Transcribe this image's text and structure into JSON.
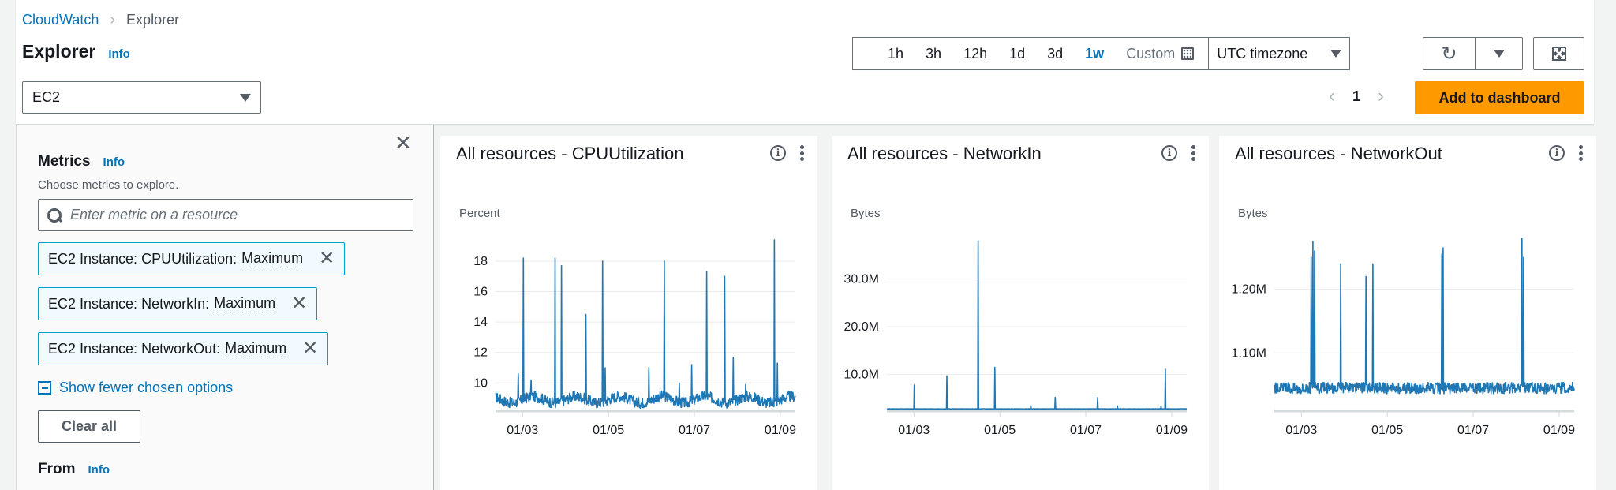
{
  "breadcrumb": {
    "parent": "CloudWatch",
    "current": "Explorer"
  },
  "header": {
    "title": "Explorer",
    "info": "Info"
  },
  "service_select": {
    "value": "EC2"
  },
  "time_range": {
    "options": [
      "1h",
      "3h",
      "12h",
      "1d",
      "3d",
      "1w"
    ],
    "selected": "1w",
    "custom_label": "Custom",
    "timezone": "UTC timezone"
  },
  "icons": {
    "refresh": "refresh-icon",
    "dropdown": "caret-down-icon",
    "fullscreen": "fullscreen-icon",
    "calendar": "calendar-icon"
  },
  "pager": {
    "prev": "‹",
    "page": "1",
    "next": "›"
  },
  "add_to_dashboard": "Add to dashboard",
  "side_panel": {
    "metrics_title": "Metrics",
    "metrics_info": "Info",
    "metrics_desc": "Choose metrics to explore.",
    "search_placeholder": "Enter metric on a resource",
    "tokens": [
      {
        "label": "EC2 Instance: CPUUtilization:",
        "stat": "Maximum"
      },
      {
        "label": "EC2 Instance: NetworkIn:",
        "stat": "Maximum"
      },
      {
        "label": "EC2 Instance: NetworkOut:",
        "stat": "Maximum"
      }
    ],
    "show_fewer": "Show fewer chosen options",
    "clear_all": "Clear all",
    "from_title": "From",
    "from_info": "Info"
  },
  "chart_data": [
    {
      "type": "line",
      "title": "All resources - CPUUtilization",
      "ylabel": "Percent",
      "xlabel": "",
      "y_ticks": [
        "10",
        "12",
        "14",
        "16",
        "18"
      ],
      "y_tick_values": [
        10,
        12,
        14,
        16,
        18
      ],
      "ylim": [
        8.2,
        19.5
      ],
      "x_ticks": [
        "01/03",
        "01/05",
        "01/07",
        "01/09"
      ],
      "x_tick_days": [
        3,
        5,
        7,
        9
      ],
      "xlim_days": [
        2.37,
        9.35
      ],
      "grid": true,
      "color": "#1f77b4",
      "baseline": 8.9,
      "noise": 0.35,
      "spikes": [
        {
          "day": 2.9,
          "value": 10.6
        },
        {
          "day": 3.02,
          "value": 18.2
        },
        {
          "day": 3.2,
          "value": 10.2
        },
        {
          "day": 3.76,
          "value": 18.2
        },
        {
          "day": 3.91,
          "value": 17.7
        },
        {
          "day": 4.47,
          "value": 14.5
        },
        {
          "day": 4.86,
          "value": 18.0
        },
        {
          "day": 4.92,
          "value": 11.0
        },
        {
          "day": 5.94,
          "value": 11.0
        },
        {
          "day": 6.3,
          "value": 18.0
        },
        {
          "day": 6.65,
          "value": 10.0
        },
        {
          "day": 6.94,
          "value": 11.2
        },
        {
          "day": 7.29,
          "value": 17.3
        },
        {
          "day": 7.7,
          "value": 17.0
        },
        {
          "day": 7.9,
          "value": 11.7
        },
        {
          "day": 8.19,
          "value": 9.9
        },
        {
          "day": 8.86,
          "value": 19.4
        },
        {
          "day": 8.93,
          "value": 11.3
        }
      ]
    },
    {
      "type": "line",
      "title": "All resources - NetworkIn",
      "ylabel": "Bytes",
      "xlabel": "",
      "y_ticks": [
        "10.0M",
        "20.0M",
        "30.0M"
      ],
      "y_tick_values": [
        10000000,
        20000000,
        30000000
      ],
      "ylim": [
        2500000,
        38500000
      ],
      "x_ticks": [
        "01/03",
        "01/05",
        "01/07",
        "01/09"
      ],
      "x_tick_days": [
        3,
        5,
        7,
        9
      ],
      "xlim_days": [
        2.37,
        9.35
      ],
      "grid": true,
      "color": "#1f77b4",
      "baseline": 2800000,
      "noise": 60000,
      "spikes": [
        {
          "day": 3.01,
          "value": 7800000
        },
        {
          "day": 3.77,
          "value": 9700000
        },
        {
          "day": 4.49,
          "value": 38000000
        },
        {
          "day": 4.88,
          "value": 11500000
        },
        {
          "day": 5.72,
          "value": 3500000
        },
        {
          "day": 6.29,
          "value": 5200000
        },
        {
          "day": 7.28,
          "value": 5200000
        },
        {
          "day": 7.73,
          "value": 3400000
        },
        {
          "day": 8.75,
          "value": 3400000
        },
        {
          "day": 8.85,
          "value": 11100000
        }
      ]
    },
    {
      "type": "line",
      "title": "All resources - NetworkOut",
      "ylabel": "Bytes",
      "xlabel": "",
      "y_ticks": [
        "1.10M",
        "1.20M"
      ],
      "y_tick_values": [
        1100000,
        1200000
      ],
      "ylim": [
        1010000,
        1280000
      ],
      "x_ticks": [
        "01/03",
        "01/05",
        "01/07",
        "01/09"
      ],
      "x_tick_days": [
        3,
        5,
        7,
        9
      ],
      "xlim_days": [
        2.37,
        9.35
      ],
      "grid": true,
      "color": "#1f77b4",
      "baseline": 1045000,
      "noise": 18000,
      "spikes": [
        {
          "day": 3.23,
          "value": 1250000
        },
        {
          "day": 3.27,
          "value": 1275000
        },
        {
          "day": 3.31,
          "value": 1260000
        },
        {
          "day": 3.92,
          "value": 1240000
        },
        {
          "day": 4.5,
          "value": 1220000
        },
        {
          "day": 4.66,
          "value": 1240000
        },
        {
          "day": 6.27,
          "value": 1255000
        },
        {
          "day": 6.3,
          "value": 1265000
        },
        {
          "day": 8.13,
          "value": 1280000
        },
        {
          "day": 8.17,
          "value": 1250000
        }
      ]
    }
  ]
}
